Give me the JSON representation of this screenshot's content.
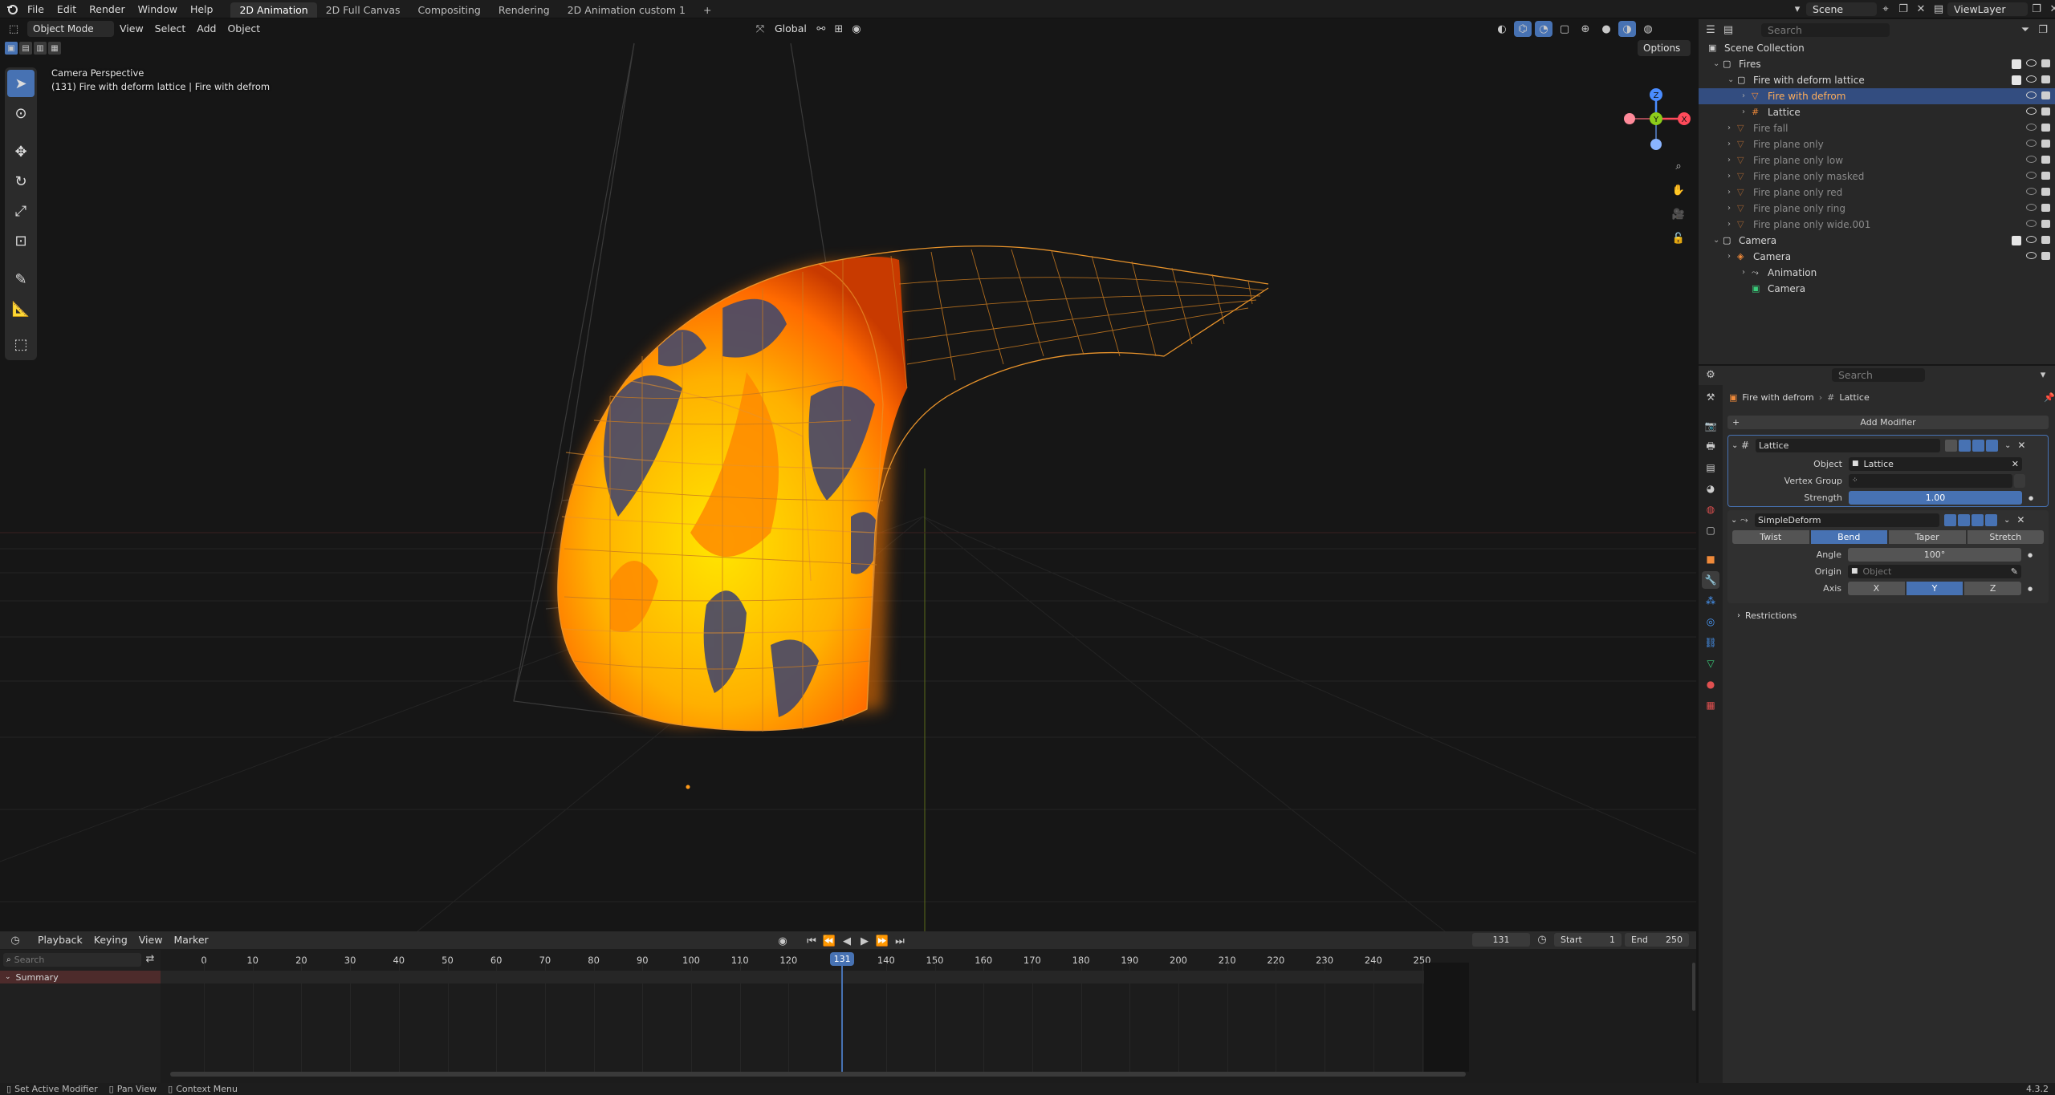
{
  "topbar": {
    "menus": [
      "File",
      "Edit",
      "Render",
      "Window",
      "Help"
    ],
    "workspaces": [
      "2D Animation",
      "2D Full Canvas",
      "Compositing",
      "Rendering",
      "2D Animation custom 1"
    ],
    "active_workspace": "2D Animation",
    "scene": "Scene",
    "view_layer": "ViewLayer"
  },
  "viewport_header": {
    "mode": "Object Mode",
    "menus": [
      "View",
      "Select",
      "Add",
      "Object"
    ],
    "transform_orientation": "Global",
    "options": "Options"
  },
  "viewport": {
    "camera_label": "Camera Perspective",
    "object_label": "(131) Fire with deform lattice | Fire with defrom"
  },
  "outliner": {
    "search_placeholder": "Search",
    "rows": [
      {
        "label": "Scene Collection",
        "indent": 0,
        "type": "scene"
      },
      {
        "label": "Fires",
        "indent": 1,
        "type": "collection",
        "checked": true
      },
      {
        "label": "Fire with deform lattice",
        "indent": 2,
        "type": "collection",
        "checked": true
      },
      {
        "label": "Fire with defrom",
        "indent": 3,
        "type": "mesh",
        "selected": true
      },
      {
        "label": "Lattice",
        "indent": 3,
        "type": "lattice"
      },
      {
        "label": "Fire fall",
        "indent": 2,
        "type": "mesh",
        "dim": true
      },
      {
        "label": "Fire plane only",
        "indent": 2,
        "type": "mesh",
        "dim": true
      },
      {
        "label": "Fire plane only low",
        "indent": 2,
        "type": "mesh",
        "dim": true
      },
      {
        "label": "Fire plane only masked",
        "indent": 2,
        "type": "mesh",
        "dim": true
      },
      {
        "label": "Fire plane only red",
        "indent": 2,
        "type": "mesh",
        "dim": true
      },
      {
        "label": "Fire plane only ring",
        "indent": 2,
        "type": "mesh",
        "dim": true
      },
      {
        "label": "Fire plane only wide.001",
        "indent": 2,
        "type": "mesh",
        "dim": true
      },
      {
        "label": "Camera",
        "indent": 1,
        "type": "collection",
        "checked": true
      },
      {
        "label": "Camera",
        "indent": 2,
        "type": "camera-obj"
      },
      {
        "label": "Animation",
        "indent": 3,
        "type": "anim"
      },
      {
        "label": "Camera",
        "indent": 3,
        "type": "camera-data"
      }
    ]
  },
  "properties": {
    "search_placeholder": "Search",
    "breadcrumb_object": "Fire with defrom",
    "breadcrumb_modifier": "Lattice",
    "add_modifier": "Add Modifier",
    "lattice_mod": {
      "name": "Lattice",
      "object_label": "Object",
      "object_value": "Lattice",
      "vgroup_label": "Vertex Group",
      "strength_label": "Strength",
      "strength_value": "1.00"
    },
    "simple_deform": {
      "name": "SimpleDeform",
      "modes": [
        "Twist",
        "Bend",
        "Taper",
        "Stretch"
      ],
      "active_mode": "Bend",
      "angle_label": "Angle",
      "angle_value": "100°",
      "origin_label": "Origin",
      "origin_placeholder": "Object",
      "axis_label": "Axis",
      "axes": [
        "X",
        "Y",
        "Z"
      ],
      "active_axis": "Y",
      "restrictions": "Restrictions"
    }
  },
  "timeline": {
    "menus": [
      "Playback",
      "Keying",
      "View",
      "Marker"
    ],
    "current_frame": "131",
    "start_label": "Start",
    "start_value": "1",
    "end_label": "End",
    "end_value": "250",
    "search_placeholder": "Search",
    "summary": "Summary",
    "ticks": [
      "0",
      "10",
      "20",
      "30",
      "40",
      "50",
      "60",
      "70",
      "80",
      "90",
      "100",
      "110",
      "120",
      "140",
      "150",
      "160",
      "170",
      "180",
      "190",
      "200",
      "210",
      "220",
      "230",
      "240",
      "250"
    ]
  },
  "statusbar": {
    "items": [
      "Set Active Modifier",
      "Pan View",
      "Context Menu"
    ],
    "version": "4.3.2"
  },
  "colors": {
    "accent": "#4772b3",
    "selection": "#334d80",
    "lattice": "#e8932b",
    "fire_core": "#ffe600",
    "fire_edge": "#ff7a00",
    "fire_dark": "#4a4a68"
  }
}
